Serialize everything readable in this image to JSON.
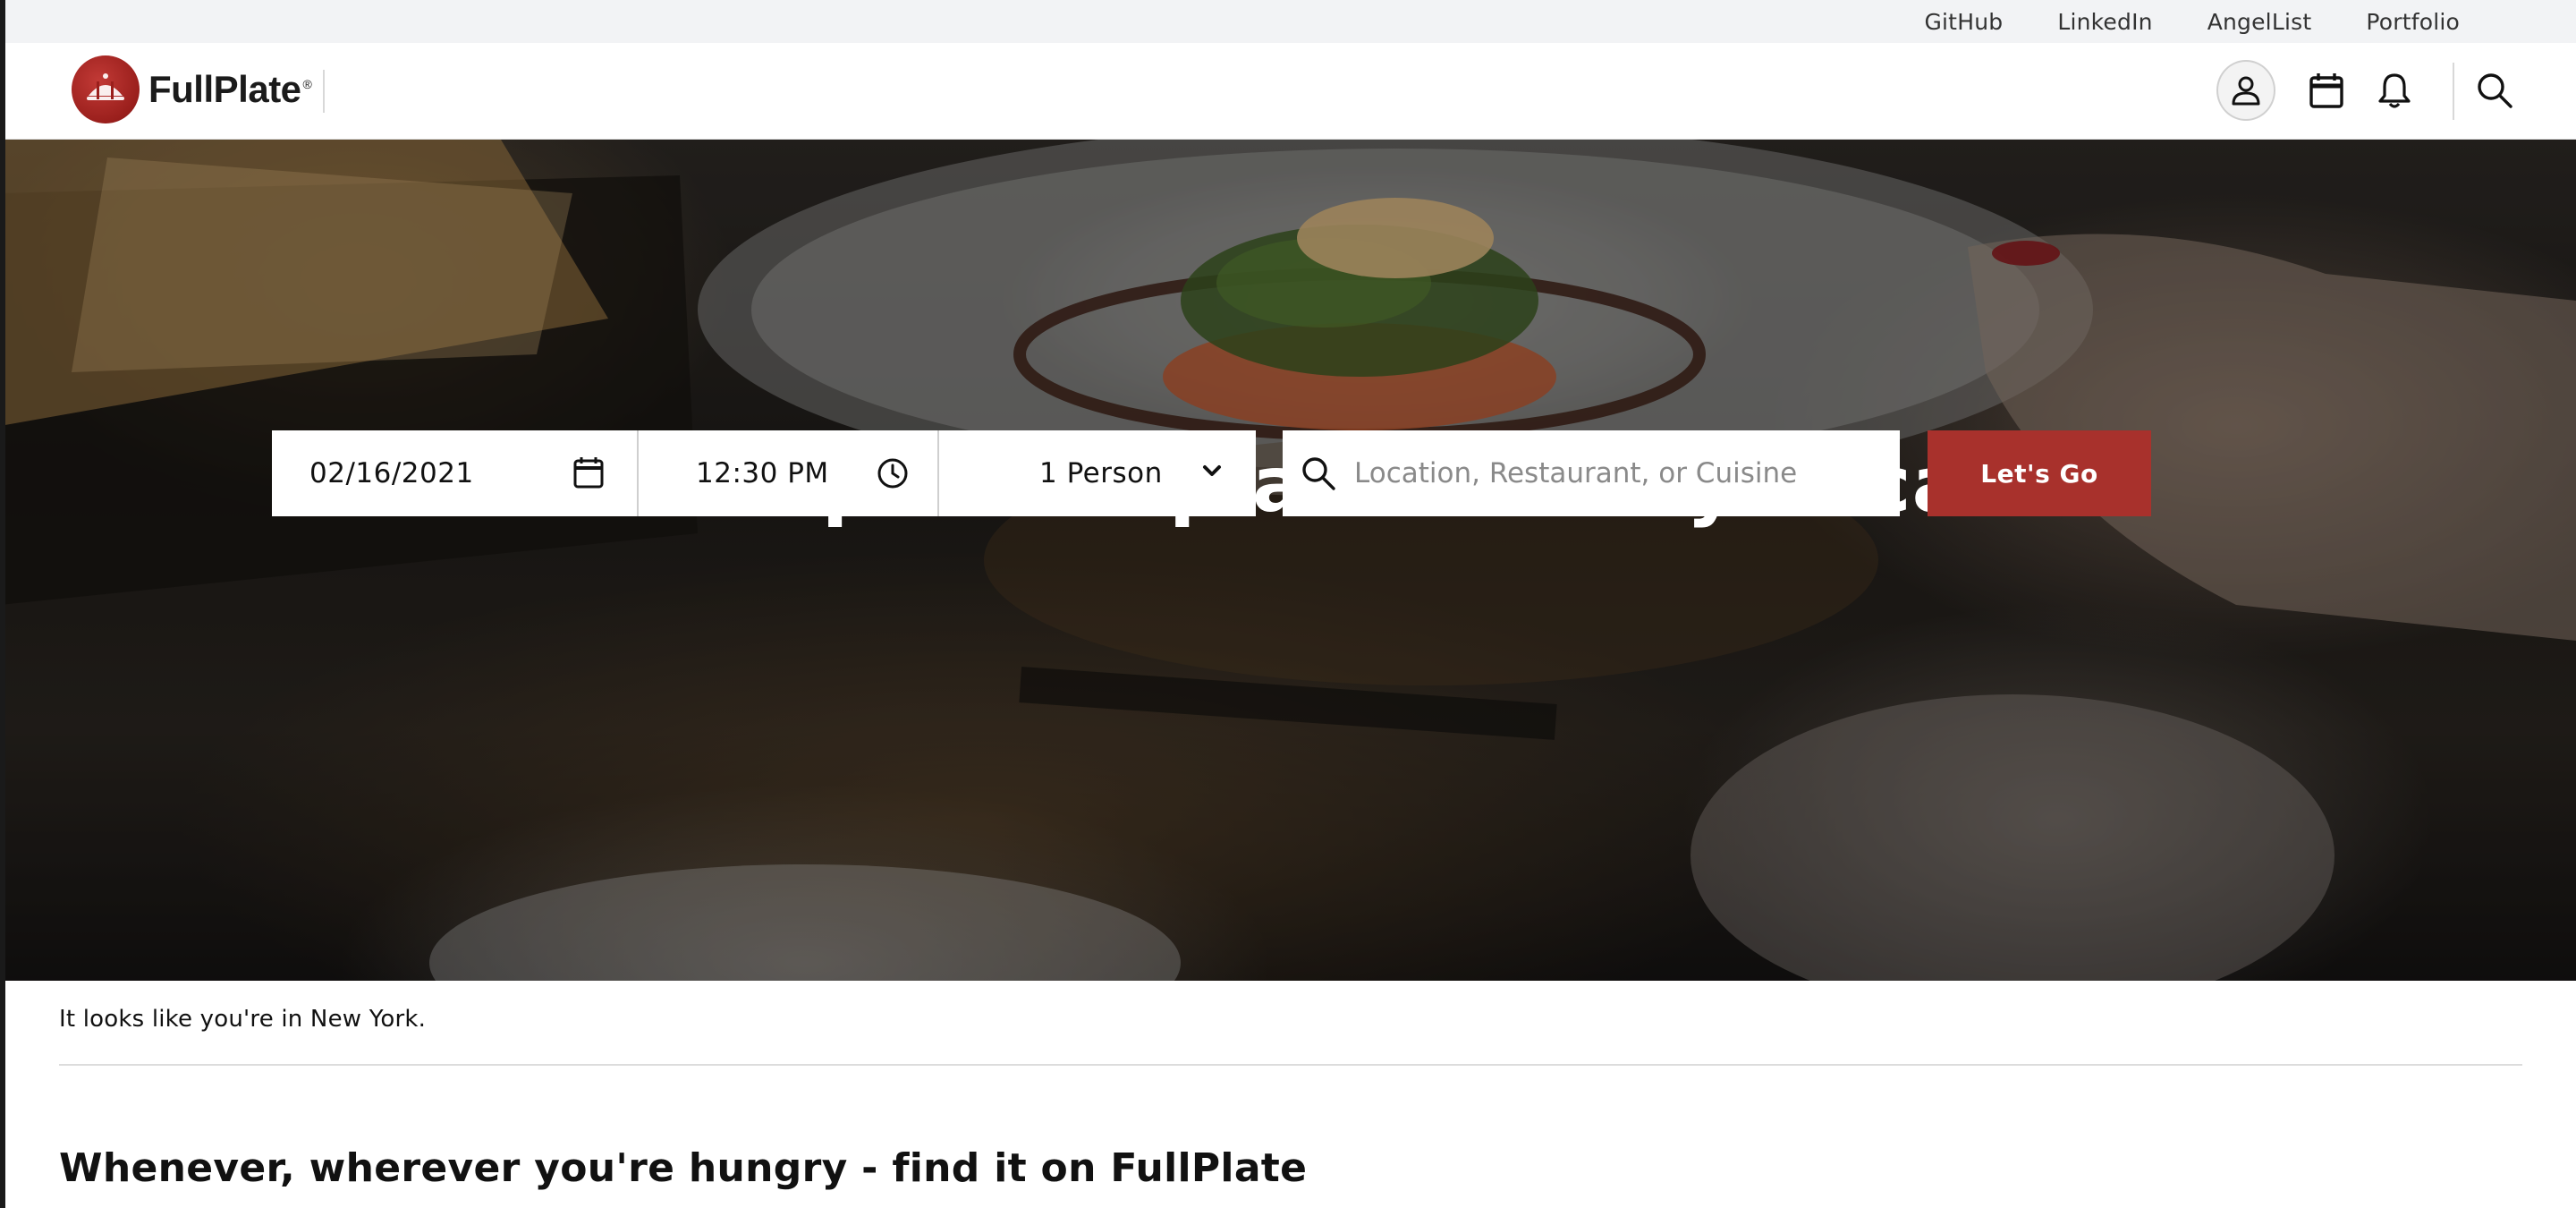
{
  "topbar": {
    "links": [
      {
        "label": "GitHub"
      },
      {
        "label": "LinkedIn"
      },
      {
        "label": "AngelList"
      },
      {
        "label": "Portfolio"
      }
    ]
  },
  "header": {
    "logo_text": "FullPlate",
    "logo_mark": "®",
    "icons": [
      "user-icon",
      "calendar-icon",
      "bell-icon",
      "search-icon"
    ]
  },
  "hero": {
    "title": "Find the perfect plate for any occasion"
  },
  "search": {
    "date_value": "02/16/2021",
    "time_value": "12:30 PM",
    "party_value": "1 Person",
    "query_placeholder": "Location, Restaurant, or Cuisine",
    "submit_label": "Let's Go"
  },
  "location_note": "It looks like you're in New York.",
  "section": {
    "title": "Whenever, wherever you're hungry - find it on FullPlate"
  },
  "colors": {
    "brand": "#a8312c",
    "topbar_bg": "#f2f3f5"
  }
}
